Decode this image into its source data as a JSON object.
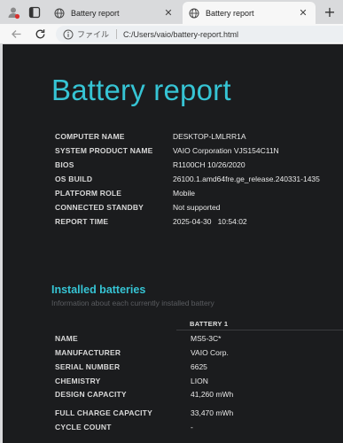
{
  "browser": {
    "tabs": [
      {
        "title": "Battery report",
        "active": false
      },
      {
        "title": "Battery report",
        "active": true
      }
    ],
    "address": {
      "scheme_label": "ファイル",
      "path": "C:/Users/vaio/battery-report.html"
    }
  },
  "report": {
    "title": "Battery report",
    "system_info": [
      {
        "key": "COMPUTER NAME",
        "value": "DESKTOP-LMLRR1A"
      },
      {
        "key": "SYSTEM PRODUCT NAME",
        "value": "VAIO Corporation VJS154C11N"
      },
      {
        "key": "BIOS",
        "value": "R1100CH 10/26/2020"
      },
      {
        "key": "OS BUILD",
        "value": "26100.1.amd64fre.ge_release.240331-1435"
      },
      {
        "key": "PLATFORM ROLE",
        "value": "Mobile"
      },
      {
        "key": "CONNECTED STANDBY",
        "value": "Not supported"
      },
      {
        "key": "REPORT TIME",
        "value": "2025-04-30   10:54:02"
      }
    ],
    "installed": {
      "title": "Installed batteries",
      "subtitle": "Information about each currently installed battery",
      "column_header": "BATTERY 1",
      "rows": [
        {
          "key": "NAME",
          "value": "MS5-3C*"
        },
        {
          "key": "MANUFACTURER",
          "value": "VAIO Corp."
        },
        {
          "key": "SERIAL NUMBER",
          "value": "6625"
        },
        {
          "key": "CHEMISTRY",
          "value": "LION"
        },
        {
          "key": "DESIGN CAPACITY",
          "value": "41,260 mWh"
        },
        {
          "key": "FULL CHARGE CAPACITY",
          "value": "33,470 mWh"
        },
        {
          "key": "CYCLE COUNT",
          "value": "-"
        }
      ]
    }
  },
  "colors": {
    "accent": "#36c4d4",
    "page_bg": "#1b1c1e",
    "chrome_bg": "#d9dadc"
  }
}
